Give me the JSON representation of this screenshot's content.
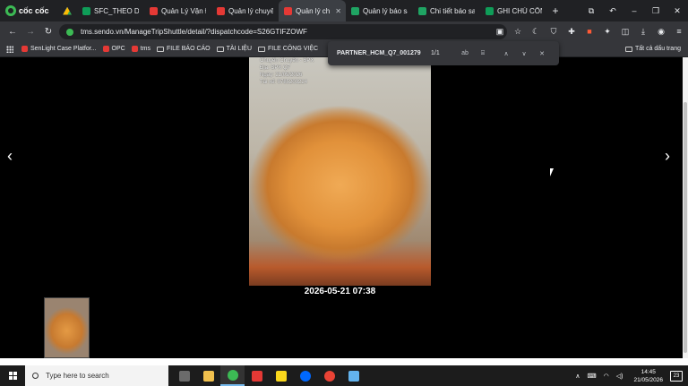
{
  "browser": {
    "brand": "cốc cốc",
    "tabs": [
      {
        "label": "SFC_THEO DÕI",
        "active": false,
        "icon_color": "#0f9d58"
      },
      {
        "label": "Quản Lý Vận Đơ",
        "active": false,
        "icon_color": "#e53935"
      },
      {
        "label": "Quản lý chuyến",
        "active": false,
        "icon_color": "#e53935"
      },
      {
        "label": "Quản lý ch",
        "active": true,
        "icon_color": "#e53935"
      },
      {
        "label": "Quản lý báo sai",
        "active": false,
        "icon_color": "#1fa463"
      },
      {
        "label": "Chi tiết báo sai",
        "active": false,
        "icon_color": "#1fa463"
      },
      {
        "label": "GHI CHÚ CÔNG",
        "active": false,
        "icon_color": "#0f9d58"
      }
    ],
    "url": "tms.sendo.vn/ManageTripShuttle/detail/?dispatchcode=S26GTIFZOWF",
    "bookmarks": [
      {
        "label": "SenLight Case Platfor...",
        "type": "site",
        "icon_color": "#e53935"
      },
      {
        "label": "OPC",
        "type": "site",
        "icon_color": "#e53935"
      },
      {
        "label": "tms",
        "type": "site",
        "icon_color": "#e53935"
      },
      {
        "label": "FILE BÁO CÁO",
        "type": "folder"
      },
      {
        "label": "TÀI LIỆU",
        "type": "folder"
      },
      {
        "label": "FILE CÔNG VIỆC",
        "type": "folder"
      }
    ],
    "all_bookmarks_label": "Tất cả dấu trang"
  },
  "find_bar": {
    "query": "PARTNER_HCM_Q7_001279",
    "count": "1/1"
  },
  "viewer": {
    "photo_stamp": [
      "Chuyển Chuyển - SPX",
      "Địa: SPX Q7",
      "Ngày: 21/05/2026",
      "Tài xế: 0785203224"
    ],
    "caption": "2026-05-21 07:38",
    "prev_arrow": "‹",
    "next_arrow": "›"
  },
  "taskbar": {
    "search_placeholder": "Type here to search",
    "apps": [
      {
        "name": "task-view",
        "color": "#6b6b6b"
      },
      {
        "name": "file-explorer",
        "color": "#f2c14e"
      },
      {
        "name": "coccoc",
        "color": "#3cba54",
        "active": true
      },
      {
        "name": "wps",
        "color": "#e53935"
      },
      {
        "name": "sticky-notes",
        "color": "#f9d71c"
      },
      {
        "name": "zalo",
        "color": "#0068ff"
      },
      {
        "name": "chrome",
        "color": "#ea4335"
      },
      {
        "name": "notepad",
        "color": "#63b3ed"
      }
    ],
    "time": "14:45",
    "date": "21/05/2026",
    "notification_count": "23"
  }
}
